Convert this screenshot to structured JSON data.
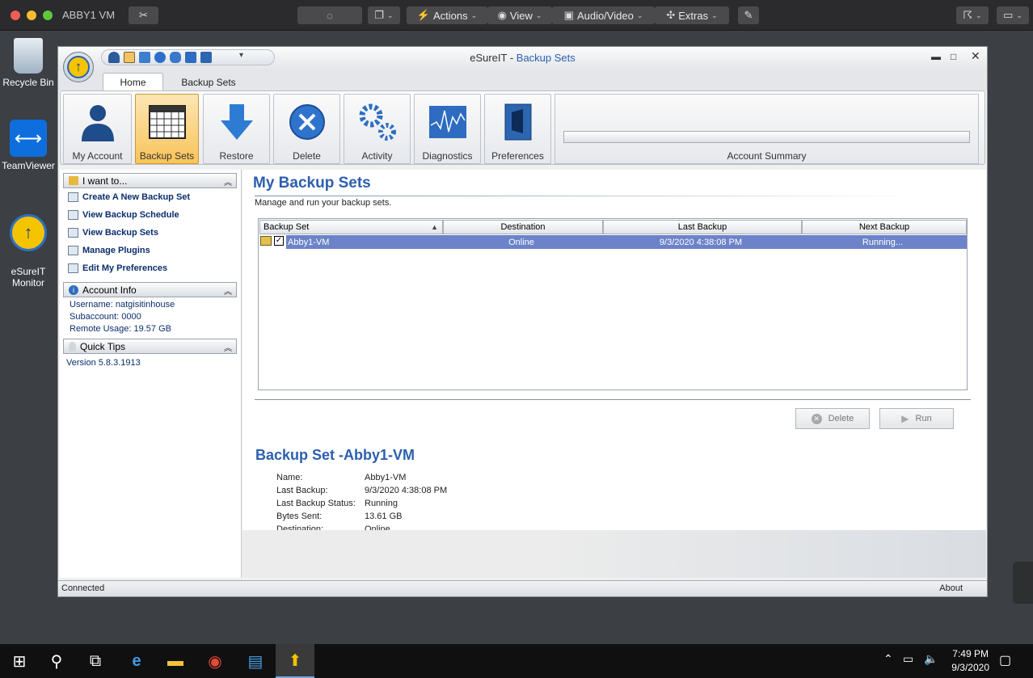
{
  "mac": {
    "vm_title": "ABBY1 VM",
    "menu": {
      "actions": "Actions",
      "view": "View",
      "audio_video": "Audio/Video",
      "extras": "Extras"
    }
  },
  "desktop": {
    "icons": [
      {
        "label": "Recycle Bin"
      },
      {
        "label": "TeamViewer"
      },
      {
        "label": "eSureIT\nMonitor"
      }
    ]
  },
  "window": {
    "title_prefix": "eSureIT - ",
    "title_accent": "Backup Sets",
    "tabs": [
      "Home",
      "Backup Sets"
    ],
    "ribbon": [
      "My Account",
      "Backup Sets",
      "Restore",
      "Delete",
      "Activity",
      "Diagnostics",
      "Preferences"
    ],
    "account_summary": "Account Summary"
  },
  "left": {
    "i_want_to": "I want to...",
    "tasks": [
      "Create A New Backup Set",
      "View Backup Schedule",
      "View Backup Sets",
      "Manage Plugins",
      "Edit My Preferences"
    ],
    "account_info_title": "Account Info",
    "username": "Username: natgisitinhouse",
    "subaccount": "Subaccount: 0000",
    "remote_usage": "Remote Usage: 19.57 GB",
    "quick_tips_title": "Quick Tips",
    "version": "Version 5.8.3.1913"
  },
  "main": {
    "title": "My Backup Sets",
    "subtitle": "Manage and run your backup sets.",
    "columns": [
      "Backup Set",
      "Destination",
      "Last Backup",
      "Next Backup"
    ],
    "rows": [
      {
        "name": "Abby1-VM",
        "destination": "Online",
        "last_backup": "9/3/2020 4:38:08 PM",
        "next_backup": "Running..."
      }
    ],
    "delete_label": "Delete",
    "run_label": "Run",
    "detail_title": "Backup Set -Abby1-VM",
    "details": {
      "name_label": "Name:",
      "name_value": "Abby1-VM",
      "last_backup_label": "Last Backup:",
      "last_backup_value": "9/3/2020 4:38:08 PM",
      "status_label": "Last Backup Status:",
      "status_value": "Running",
      "bytes_label": "Bytes Sent:",
      "bytes_value": "13.61 GB",
      "dest_label": "Destination:",
      "dest_value": "Online"
    }
  },
  "status": {
    "left": "Connected",
    "right": "About"
  },
  "taskbar": {
    "time": "7:49 PM",
    "date": "9/3/2020"
  }
}
